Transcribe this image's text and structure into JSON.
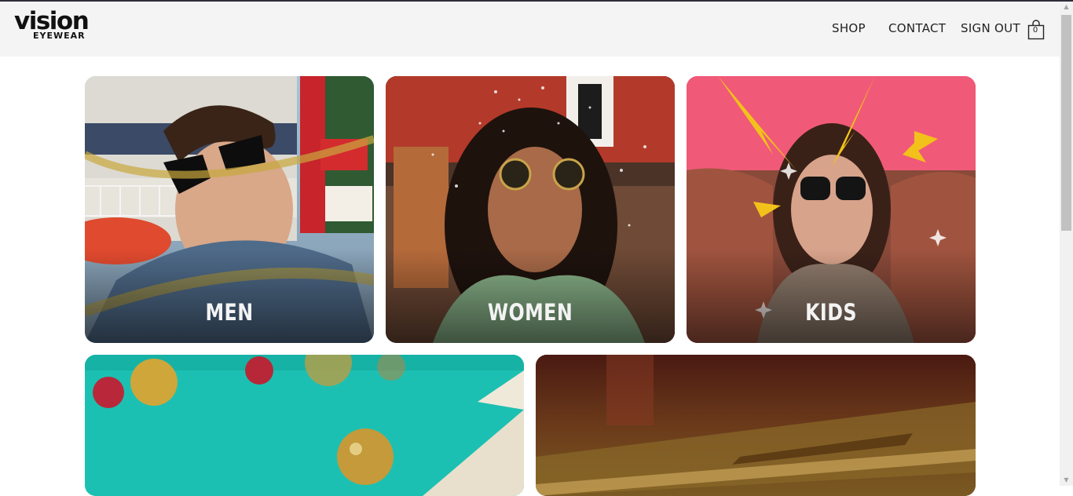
{
  "header": {
    "logo": {
      "main": "vision",
      "sub": "EYEWEAR"
    },
    "nav": {
      "shop": "SHOP",
      "contact": "CONTACT",
      "sign_out": "SIGN OUT"
    },
    "cart": {
      "count": "0"
    }
  },
  "categories": [
    {
      "label": "MEN"
    },
    {
      "label": "WOMEN"
    },
    {
      "label": "KIDS"
    }
  ],
  "colors": {
    "header_bg": "#f4f4f4",
    "top_line": "#2d2d3a",
    "text": "#222222",
    "label_text": "#f3f3f3"
  }
}
